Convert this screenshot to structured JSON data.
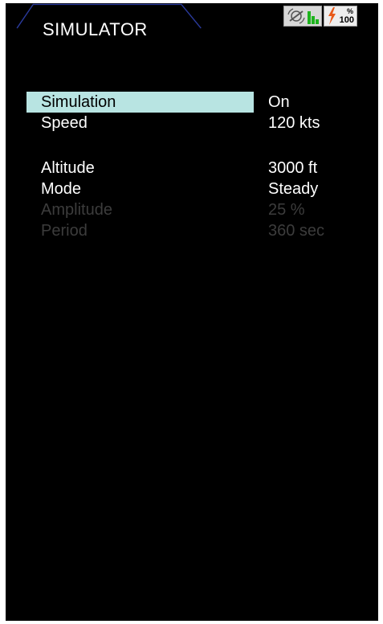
{
  "header": {
    "title": "SIMULATOR",
    "status": {
      "icons": [
        "gps-signal-icon",
        "signal-bars-icon",
        "battery-charging-icon"
      ],
      "battery_unit": "%",
      "battery_value": "100",
      "colors": {
        "tab_border": "#2a3a9c",
        "signal_green": "#1db31d",
        "charge_orange": "#e85a1a"
      }
    }
  },
  "menu": {
    "items": [
      {
        "label": "Simulation",
        "value": "On",
        "state": "selected"
      },
      {
        "label": "Speed",
        "value": "120 kts",
        "state": "enabled"
      },
      {
        "label": "Altitude",
        "value": "3000 ft",
        "state": "enabled"
      },
      {
        "label": "Mode",
        "value": "Steady",
        "state": "enabled"
      },
      {
        "label": "Amplitude",
        "value": "25 %",
        "state": "disabled"
      },
      {
        "label": "Period",
        "value": "360 sec",
        "state": "disabled"
      }
    ],
    "colors": {
      "highlight": "#b8e4e2",
      "text": "#ffffff",
      "disabled_text": "#3c3c3c"
    }
  }
}
